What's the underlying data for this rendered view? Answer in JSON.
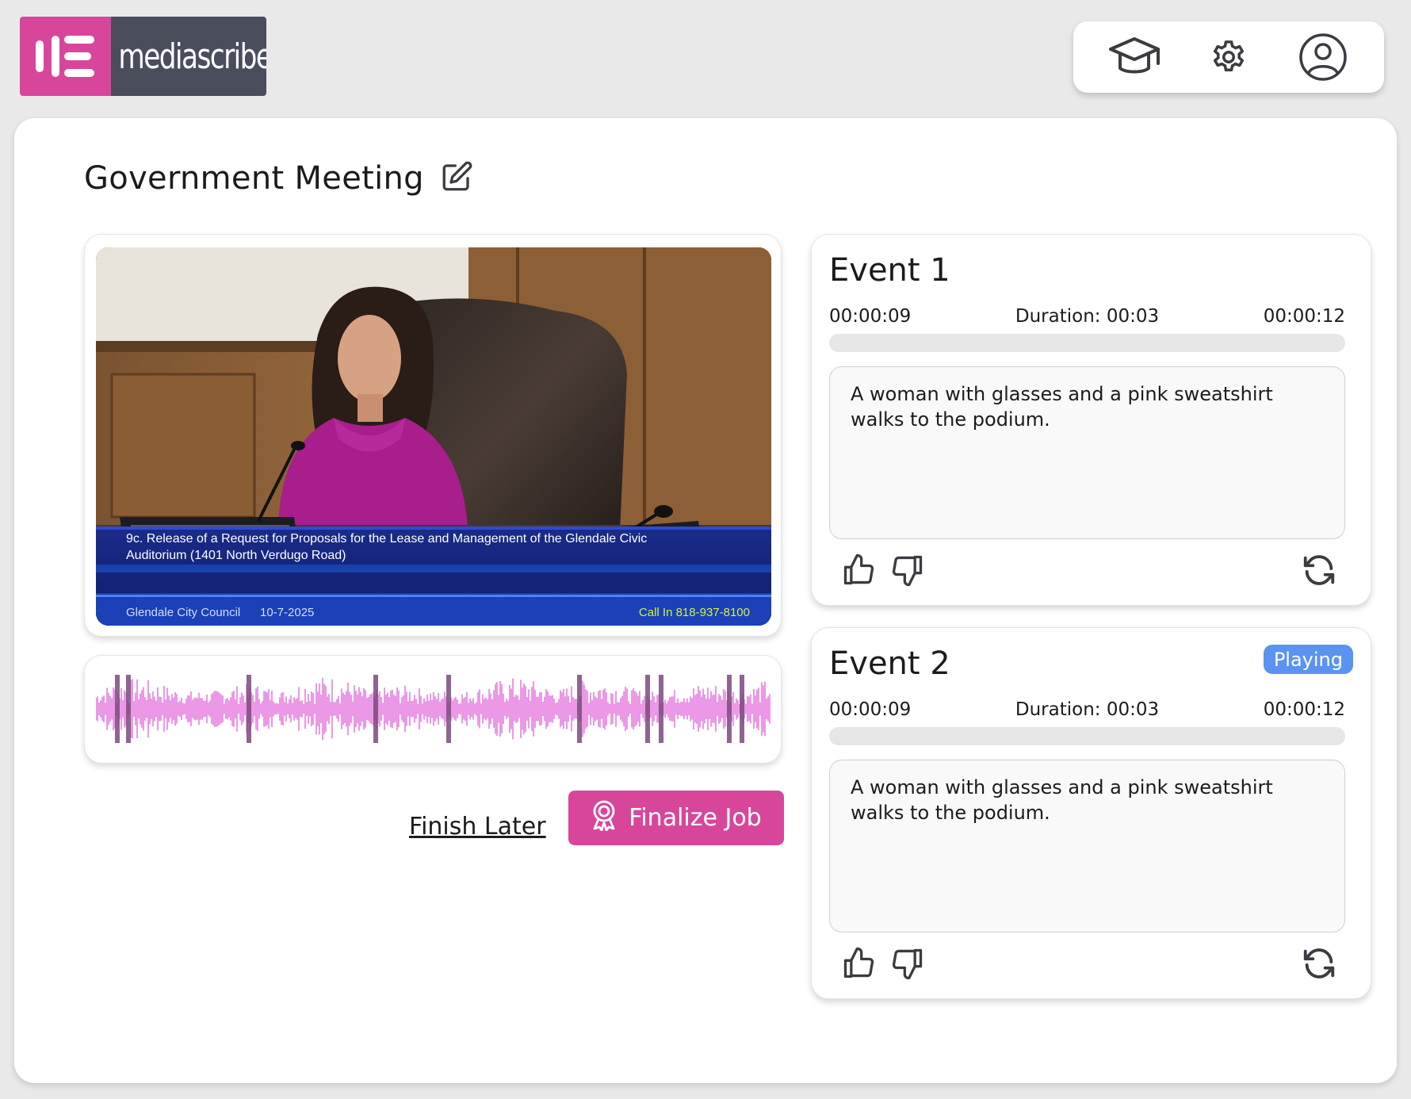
{
  "app": {
    "name_part1": "media",
    "name_part2": "scribe",
    "brand_color": "#d8469b",
    "brand_dark": "#4a4d5c"
  },
  "toolbar": {
    "icons": [
      "graduation-cap-icon",
      "gear-icon",
      "user-icon"
    ]
  },
  "page": {
    "title": "Government Meeting"
  },
  "video": {
    "caption_line1": "9c. Release of a Request for Proposals for the Lease and Management of the Glendale Civic",
    "caption_line2": "Auditorium (1401 North Verdugo Road)",
    "channel": "Glendale City Council",
    "date": "10-7-2025",
    "call_in": "Call In 818-937-8100"
  },
  "waveform": {
    "color": "#e67fe0",
    "marker_color": "#7a4a7c"
  },
  "actions": {
    "finish_later": "Finish Later",
    "finalize": "Finalize Job"
  },
  "events": [
    {
      "title": "Event 1",
      "start": "00:00:09",
      "duration": "Duration: 00:03",
      "end": "00:00:12",
      "progress": 0,
      "description": "A woman with glasses and a pink sweatshirt walks to the podium.",
      "badge": ""
    },
    {
      "title": "Event 2",
      "start": "00:00:09",
      "duration": "Duration: 00:03",
      "end": "00:00:12",
      "progress": 0,
      "description": "A woman with glasses and a pink sweatshirt walks to the podium.",
      "badge": "Playing"
    }
  ]
}
